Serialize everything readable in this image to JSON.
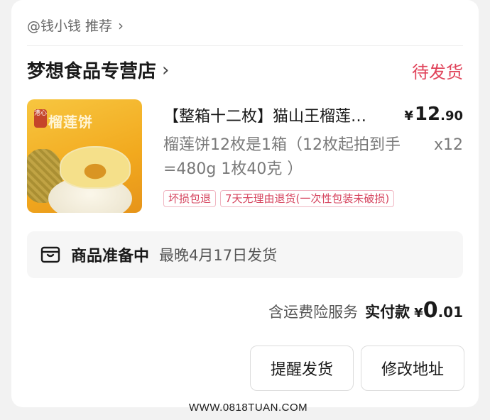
{
  "recommender": {
    "text": "@钱小钱 推荐",
    "chevron": "›"
  },
  "shop": {
    "name": "梦想食品专营店",
    "chevron": "›"
  },
  "order": {
    "status": "待发货"
  },
  "product": {
    "thumb_title": "榴莲饼",
    "thumb_seal": "港心",
    "title": "【整箱十二枚】猫山王榴莲…",
    "price": {
      "currency": "¥",
      "integer": "12",
      "decimal": ".90"
    },
    "spec": "榴莲饼12枚是1箱（12枚起拍到手=480g 1枚40克 ）",
    "quantity": "x12",
    "tags": [
      "坏损包退",
      "7天无理由退货(一次性包装未破损)"
    ]
  },
  "preparation": {
    "icon": "parcel-icon",
    "title": "商品准备中",
    "eta": "最晚4月17日发货"
  },
  "payment": {
    "service": "含运费险服务",
    "label": "实付款",
    "currency": "¥",
    "integer": "0",
    "decimal": ".01"
  },
  "buttons": {
    "remind": "提醒发货",
    "change_address": "修改地址"
  },
  "watermark": "WWW.0818TUAN.COM",
  "colors": {
    "status": "#e0435a",
    "tag": "#d6455f",
    "background": "#f2f2f2"
  }
}
